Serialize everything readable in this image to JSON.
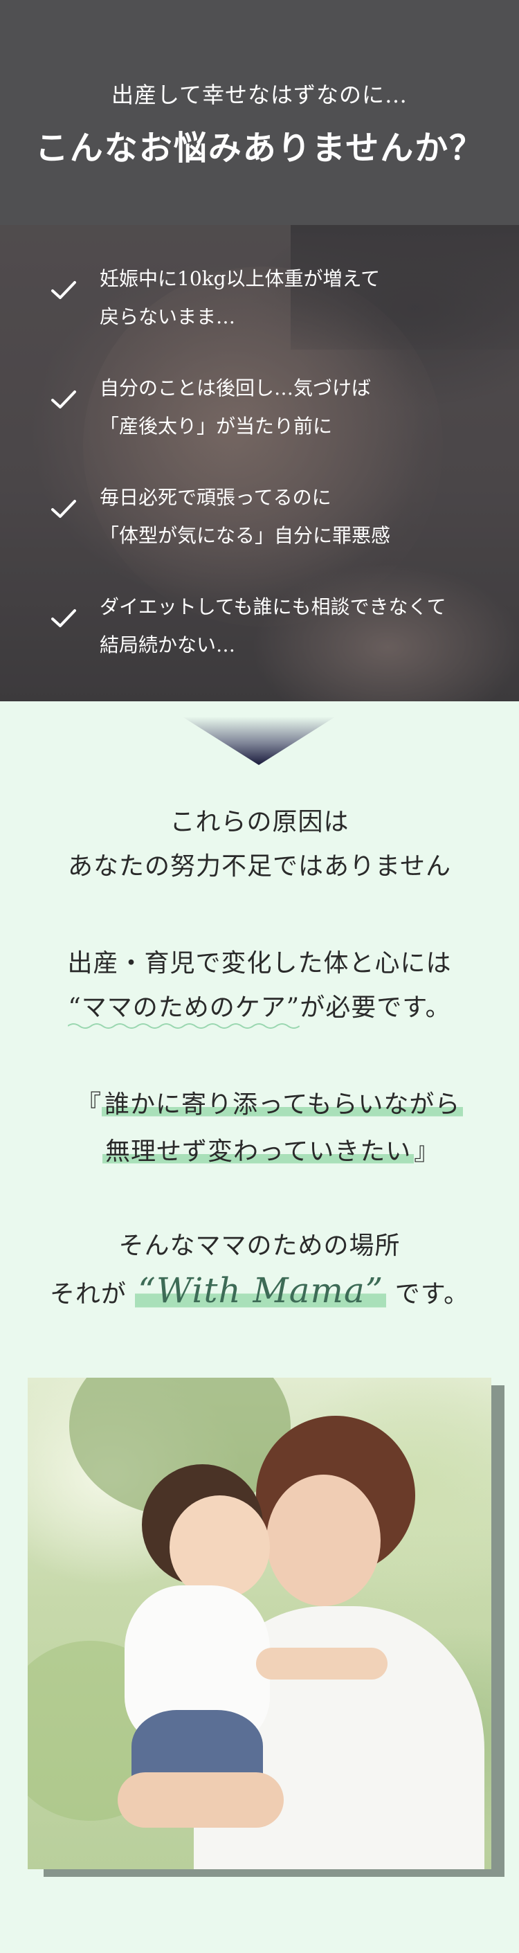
{
  "hero": {
    "subtitle": "出産して幸せなはずなのに…",
    "title": "こんなお悩みありませんか？",
    "worries": [
      {
        "line1": "妊娠中に10kg以上体重が増えて",
        "line2": "戻らないまま…"
      },
      {
        "line1": "自分のことは後回し…気づけば",
        "line2": "「産後太り」が当たり前に"
      },
      {
        "line1": "毎日必死で頑張ってるのに",
        "line2": "「体型が気になる」自分に罪悪感"
      },
      {
        "line1": "ダイエットしても誰にも相談できなくて",
        "line2": "結局続かない…"
      }
    ]
  },
  "message": {
    "cause_line1": "これらの原因は",
    "cause_line2": "あなたの努力不足ではありません",
    "need_line1": "出産・育児で変化した体と心には",
    "need_quote": "“ママのためのケア”",
    "need_tail": "が必要です。",
    "wish_open": "『",
    "wish_line1": "誰かに寄り添ってもらいながら",
    "wish_line2": "無理せず変わっていきたい",
    "wish_close": "』",
    "place_line": "そんなママのための場所",
    "brand_prefix": "それが",
    "brand_name": "“With Mama”",
    "brand_suffix": "です。"
  },
  "colors": {
    "hero_bg": "#505052",
    "section_bg": "#eaf9ee",
    "highlight": "#a9e0b9",
    "arrow": "#1a1b3c",
    "brand_green": "#3d6b56",
    "photo_shadow": "#87958c"
  },
  "icons": {
    "check": "check-icon",
    "arrow": "down-arrow-icon"
  }
}
